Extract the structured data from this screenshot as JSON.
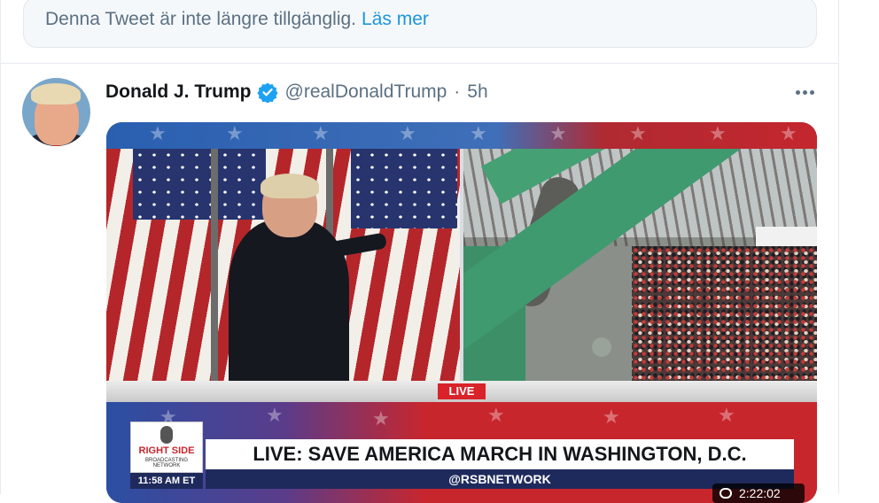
{
  "notice": {
    "text": "Denna Tweet är inte längre tillgänglig.",
    "link": "Läs mer"
  },
  "tweet": {
    "display_name": "Donald J. Trump",
    "verified": true,
    "handle": "@realDonaldTrump",
    "separator": "·",
    "time": "5h",
    "more_icon": "more-dots-icon"
  },
  "media": {
    "live_badge": "LIVE",
    "logo_text": "RIGHT SIDE",
    "logo_sub": "BROADCASTING NETWORK",
    "clock": "11:58 AM ET",
    "headline": "LIVE: SAVE AMERICA MARCH IN WASHINGTON, D.C.",
    "sub_ticker": "@RSBNETWORK",
    "duration": "2:22:02"
  },
  "colors": {
    "accent": "#1b95e0",
    "verified_badge": "#1da1f2",
    "secondary_text": "#5b7083",
    "live_red": "#d8232a"
  }
}
